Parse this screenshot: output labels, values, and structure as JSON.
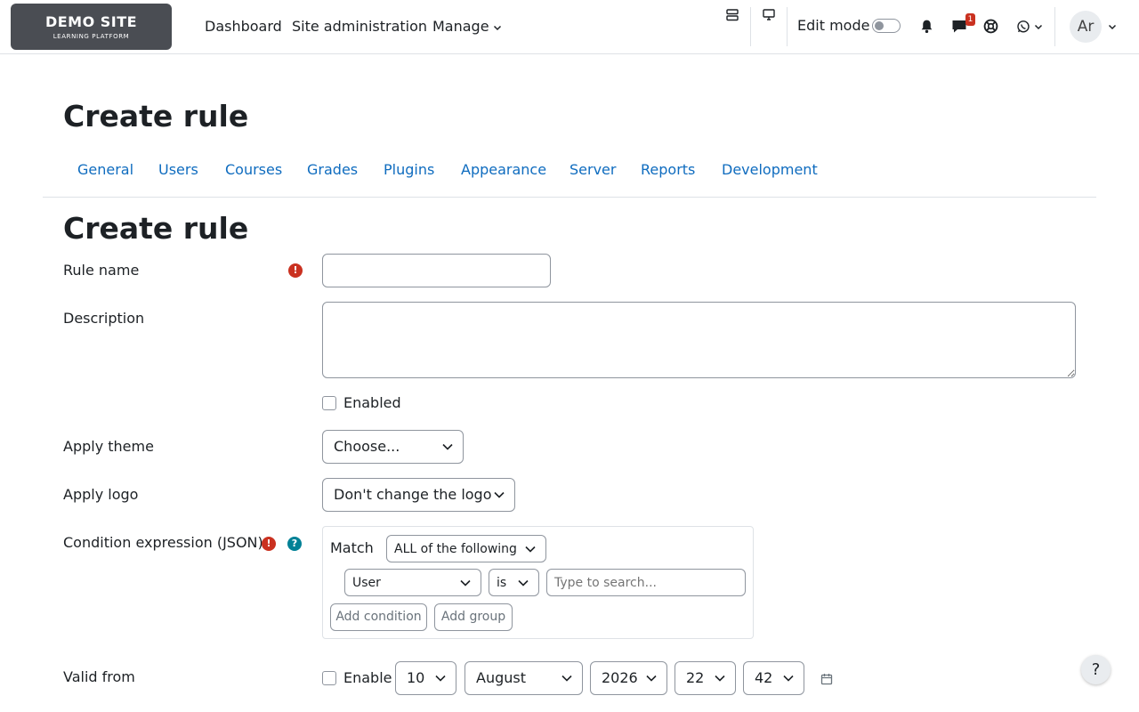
{
  "navbar": {
    "logo_title": "DEMO SITE",
    "logo_subtitle": "LEARNING PLATFORM",
    "links": [
      "Dashboard",
      "Site administration",
      "Manage"
    ],
    "edit_mode_label": "Edit mode",
    "messages_badge": "1",
    "avatar_initials": "Ar"
  },
  "page": {
    "heading": "Create rule",
    "tabs": [
      "General",
      "Users",
      "Courses",
      "Grades",
      "Plugins",
      "Appearance",
      "Server",
      "Reports",
      "Development"
    ],
    "section_heading": "Create rule"
  },
  "form": {
    "rule_name_label": "Rule name",
    "rule_name_value": "",
    "description_label": "Description",
    "description_value": "",
    "enabled_label": "Enabled",
    "enabled_checked": false,
    "apply_theme_label": "Apply theme",
    "apply_theme_value": "Choose...",
    "apply_logo_label": "Apply logo",
    "apply_logo_value": "Don't change the logo",
    "condition_label": "Condition expression (JSON)",
    "condition": {
      "match_label": "Match",
      "match_value": "ALL of the following",
      "field_value": "User",
      "operator_value": "is",
      "search_placeholder": "Type to search...",
      "add_condition_label": "Add condition",
      "add_group_label": "Add group"
    },
    "valid_from_label": "Valid from",
    "valid_from": {
      "enable_label": "Enable",
      "enable_checked": false,
      "day": "10",
      "month": "August",
      "year": "2026",
      "hour": "22",
      "minute": "42"
    }
  },
  "help_button_label": "?",
  "colors": {
    "link": "#0f6cbf",
    "required": "#ca3120",
    "help": "#008196",
    "logo_bg": "#4a4d53"
  }
}
